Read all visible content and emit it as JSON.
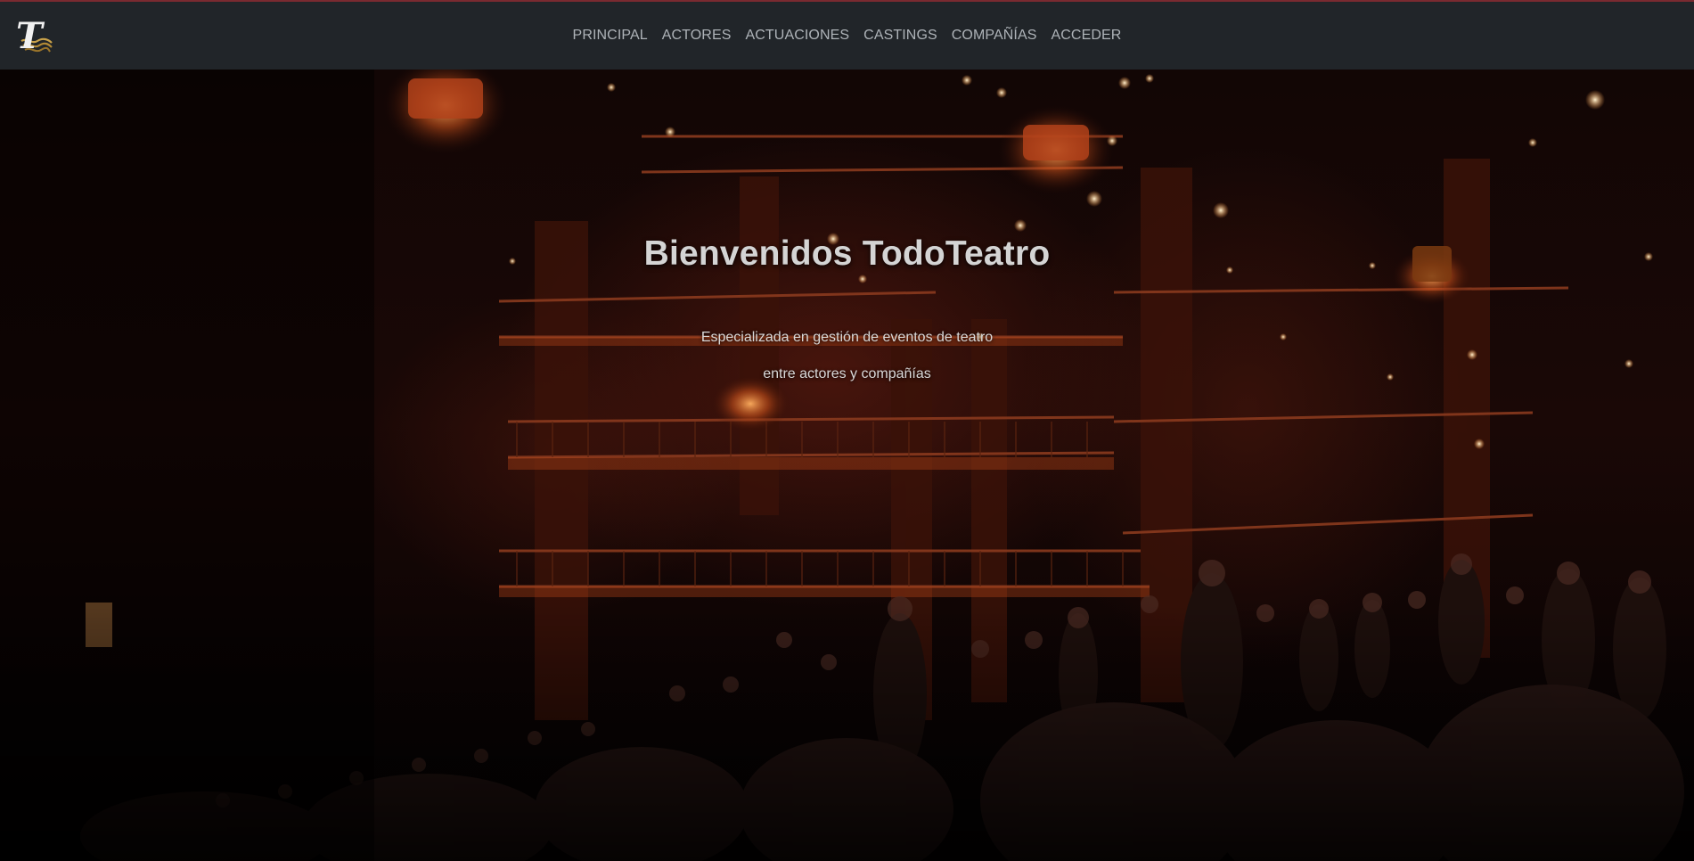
{
  "nav": {
    "logo_letter": "T",
    "links": [
      "PRINCIPAL",
      "ACTORES",
      "ACTUACIONES",
      "CASTINGS",
      "COMPAÑÍAS",
      "ACCEDER"
    ]
  },
  "hero": {
    "title": "Bienvenidos TodoTeatro",
    "subtitle_line1": "Especializada en gestión de eventos de teatro",
    "subtitle_line2": "entre actores y compañías"
  },
  "colors": {
    "navbar_bg": "#212529",
    "nav_link": "#aeb3b8",
    "navbar_accent": "#7a2a30",
    "logo_gold": "#c9a24a",
    "hero_title": "#d4d4d4"
  }
}
